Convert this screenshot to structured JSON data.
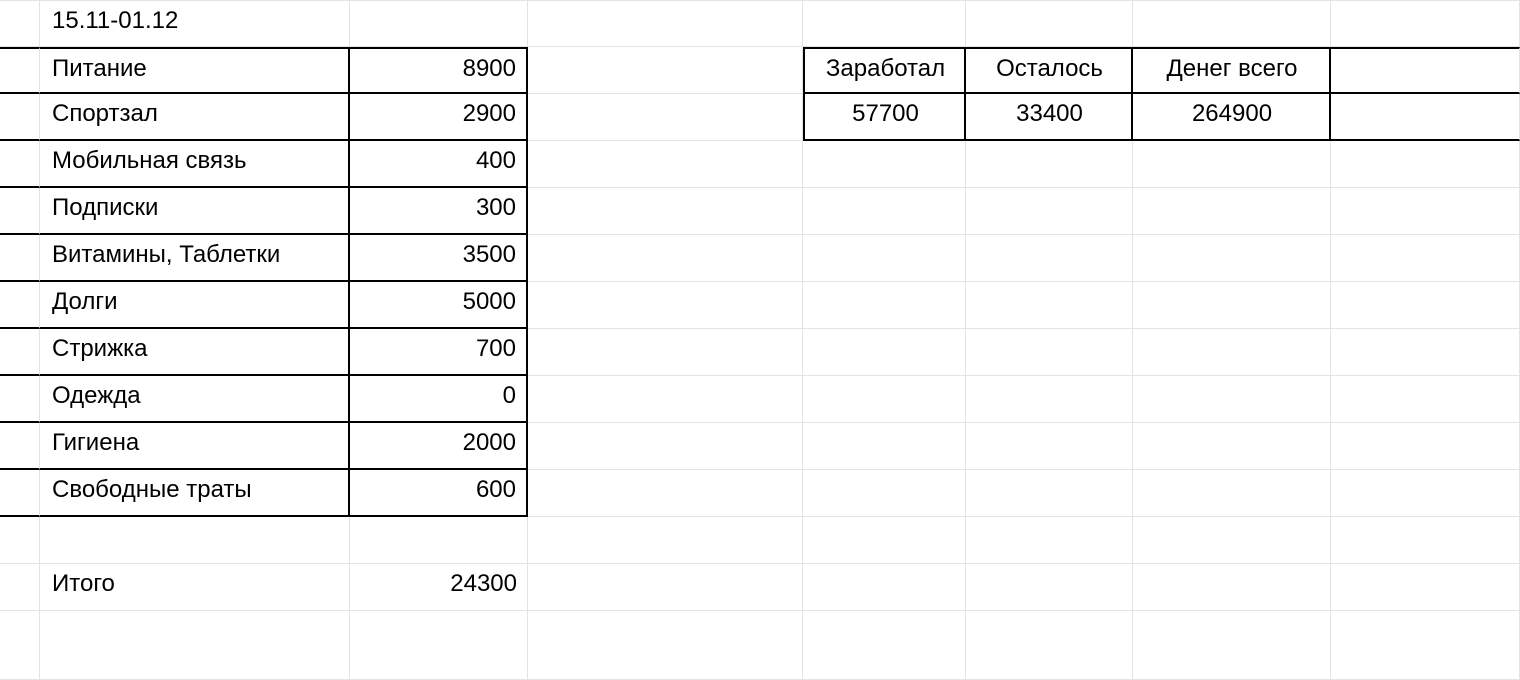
{
  "budget": {
    "period": "15.11-01.12",
    "expenses": [
      {
        "label": "Питание",
        "amount": "8900"
      },
      {
        "label": "Спортзал",
        "amount": "2900"
      },
      {
        "label": "Мобильная связь",
        "amount": "400"
      },
      {
        "label": "Подписки",
        "amount": "300"
      },
      {
        "label": "Витамины, Таблетки",
        "amount": "3500"
      },
      {
        "label": "Долги",
        "amount": "5000"
      },
      {
        "label": "Стрижка",
        "amount": "700"
      },
      {
        "label": "Одежда",
        "amount": "0"
      },
      {
        "label": "Гигиена",
        "amount": "2000"
      },
      {
        "label": "Свободные траты",
        "amount": "600"
      }
    ],
    "total_label": "Итого",
    "total_amount": "24300",
    "summary": {
      "earned_label": "Заработал",
      "remaining_label": "Осталось",
      "total_money_label": "Денег всего",
      "earned": "57700",
      "remaining": "33400",
      "total_money": "264900"
    }
  }
}
